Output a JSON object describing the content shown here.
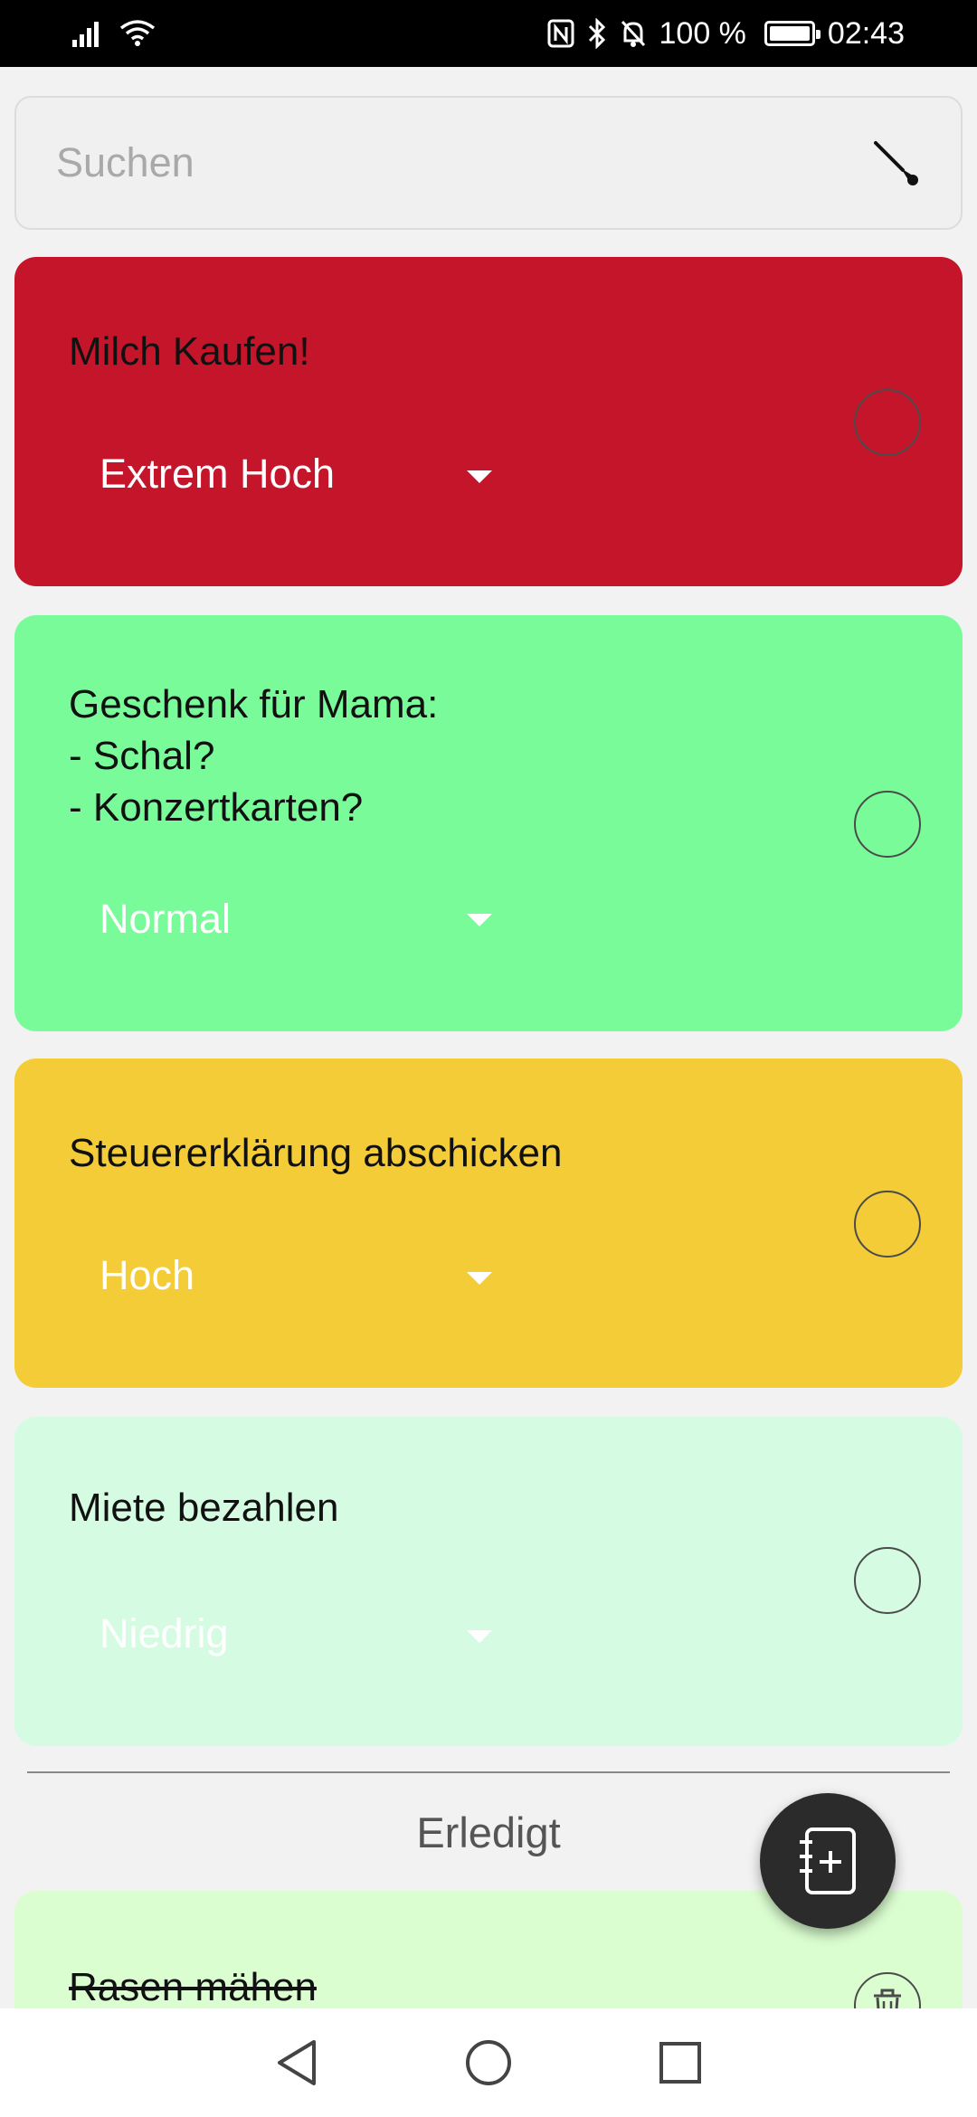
{
  "status": {
    "battery": "100 %",
    "time": "02:43"
  },
  "search": {
    "placeholder": "Suchen",
    "icon": "brush-icon"
  },
  "tasks": [
    {
      "title": "Milch Kaufen!",
      "priority": "Extrem Hoch",
      "color": "#c4152a",
      "done": false
    },
    {
      "title": "Geschenk für Mama:\n- Schal?\n- Konzertkarten?",
      "priority": "Normal",
      "color": "#79fb9a",
      "done": false
    },
    {
      "title": "Steuererklärung abschicken",
      "priority": "Hoch",
      "color": "#f4cc38",
      "done": false
    },
    {
      "title": "Miete bezahlen",
      "priority": "Niedrig",
      "color": "#d5fce2",
      "done": false
    }
  ],
  "done_section": {
    "label": "Erledigt",
    "items": [
      {
        "title": "Rasen mähen",
        "color": "#dbfed0"
      }
    ]
  },
  "fab": {
    "icon": "add-note-icon"
  },
  "nav": {
    "back_icon": "back-icon",
    "home_icon": "home-icon",
    "recents_icon": "recents-icon"
  }
}
